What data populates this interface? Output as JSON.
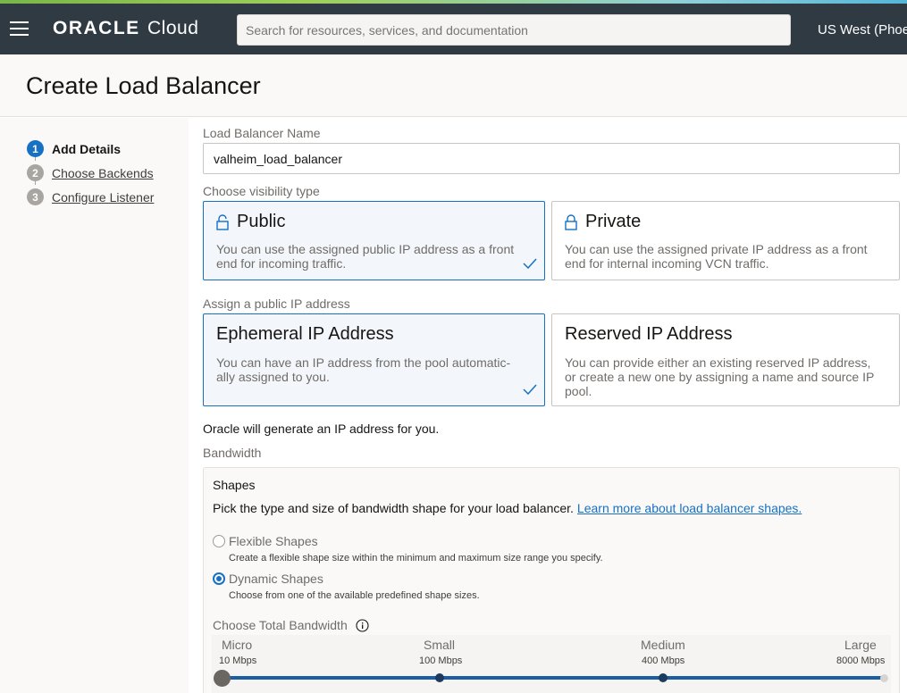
{
  "header": {
    "brand": "ORACLE",
    "product": "Cloud",
    "search_placeholder": "Search for resources, services, and documentation",
    "region": "US West (Phoenix)"
  },
  "page": {
    "title": "Create Load Balancer"
  },
  "steps": [
    {
      "number": "1",
      "label": "Add Details",
      "active": true
    },
    {
      "number": "2",
      "label": "Choose Backends",
      "active": false
    },
    {
      "number": "3",
      "label": "Configure Listener",
      "active": false
    }
  ],
  "form": {
    "name_label": "Load Balancer Name",
    "name_value": "valheim_load_balancer",
    "visibility_label": "Choose visibility type",
    "visibility_options": [
      {
        "title": "Public",
        "description": "You can use the assigned public IP address as a front end for incoming traffic.",
        "selected": true,
        "icon": "lock-open-icon"
      },
      {
        "title": "Private",
        "description": "You can use the assigned private IP address as a front end for internal incoming VCN traffic.",
        "selected": false,
        "icon": "lock-icon"
      }
    ],
    "ip_label": "Assign a public IP address",
    "ip_options": [
      {
        "title": "Ephemeral IP Address",
        "description": "You can have an IP address from the pool automatic-ally assigned to you.",
        "selected": true
      },
      {
        "title": "Reserved IP Address",
        "description": "You can provide either an existing reserved IP address, or create a new one by assigning a name and source IP pool.",
        "selected": false
      }
    ],
    "ip_note": "Oracle will generate an IP address for you.",
    "bandwidth_label": "Bandwidth",
    "shapes": {
      "title": "Shapes",
      "description": "Pick the type and size of bandwidth shape for your load balancer.",
      "link": "Learn more about load balancer shapes.",
      "options": [
        {
          "label": "Flexible Shapes",
          "sub": "Create a flexible shape size within the minimum and maximum size range you specify.",
          "checked": false
        },
        {
          "label": "Dynamic Shapes",
          "sub": "Choose from one of the available predefined shape sizes.",
          "checked": true
        }
      ],
      "total_bandwidth_label": "Choose Total Bandwidth",
      "slider": {
        "stops": [
          {
            "name": "Micro",
            "value": "10 Mbps"
          },
          {
            "name": "Small",
            "value": "100 Mbps"
          },
          {
            "name": "Medium",
            "value": "400 Mbps"
          },
          {
            "name": "Large",
            "value": "8000 Mbps"
          }
        ],
        "selected": "Micro"
      }
    }
  },
  "colors": {
    "accent": "#1671c3",
    "topbar": "#2f3a43"
  }
}
